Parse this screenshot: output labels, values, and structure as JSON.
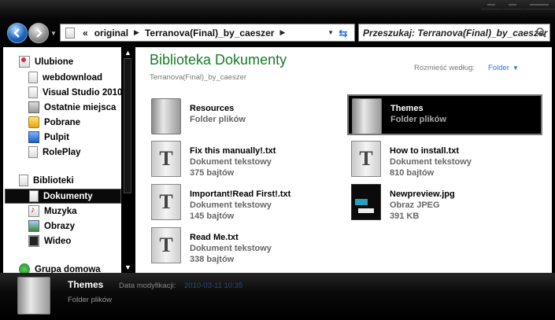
{
  "address_bar": {
    "overflow": "«",
    "crumbs": [
      "original",
      "Terranova(Final)_by_caeszer"
    ]
  },
  "search": {
    "placeholder": "Przeszukaj: Terranova(Final)_by_caeszer"
  },
  "sidebar": {
    "favorites_label": "Ulubione",
    "favorites": [
      "webdownload",
      "Visual Studio 2010",
      "Ostatnie miejsca",
      "Pobrane",
      "Pulpit",
      "RolePlay"
    ],
    "libraries_label": "Biblioteki",
    "libraries": [
      "Dokumenty",
      "Muzyka",
      "Obrazy",
      "Wideo"
    ],
    "homegroup_label": "Grupa domowa"
  },
  "main": {
    "title": "Biblioteka Dokumenty",
    "subtitle": "Terranova(Final)_by_caeszer",
    "arrange_label": "Rozmieść według:",
    "arrange_value": "Folder",
    "items": [
      {
        "name": "Resources",
        "type": "Folder plików",
        "size": "",
        "icon": "folder-icon"
      },
      {
        "name": "Themes",
        "type": "Folder plików",
        "size": "",
        "icon": "folder-icon"
      },
      {
        "name": "Fix this manually!.txt",
        "type": "Dokument tekstowy",
        "size": "375 bajtów",
        "icon": "text-file-icon"
      },
      {
        "name": "How to install.txt",
        "type": "Dokument tekstowy",
        "size": "810 bajtów",
        "icon": "text-file-icon"
      },
      {
        "name": "Important!Read First!.txt",
        "type": "Dokument tekstowy",
        "size": "145 bajtów",
        "icon": "text-file-icon"
      },
      {
        "name": "Newpreview.jpg",
        "type": "Obraz JPEG",
        "size": "391 KB",
        "icon": "image-file-icon"
      },
      {
        "name": "Read Me.txt",
        "type": "Dokument tekstowy",
        "size": "338 bajtów",
        "icon": "text-file-icon"
      }
    ]
  },
  "details": {
    "name": "Themes",
    "date_label": "Data modyfikacji:",
    "date": "2010-03-11 10:35",
    "type": "Folder plików"
  },
  "colors": {
    "title_green": "#1a7a2a",
    "link_blue": "#2a6ed8",
    "chrome_black": "#000000"
  }
}
